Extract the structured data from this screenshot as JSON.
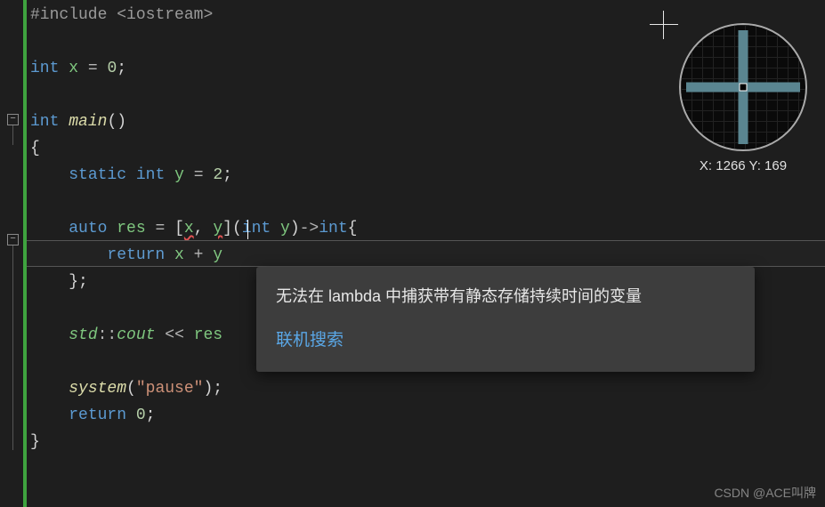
{
  "code": {
    "l1_directive": "#include",
    "l1_header": "<iostream>",
    "l3_type": "int",
    "l3_var": "x",
    "l3_eq": "=",
    "l3_val": "0",
    "l5_type": "int",
    "l5_func": "main",
    "l5_paren": "()",
    "l6_brace": "{",
    "l7_static": "static",
    "l7_int": "int",
    "l7_var": "y",
    "l7_eq": "=",
    "l7_val": "2",
    "l9_auto": "auto",
    "l9_var": "res",
    "l9_eq": "=",
    "l9_lbrack": "[",
    "l9_cap1": "x",
    "l9_comma": ",",
    "l9_cap2": "y",
    "l9_rbrack": "]",
    "l9_lparen": "(",
    "l9_ptype": "int",
    "l9_pname": "y",
    "l9_rparen": ")",
    "l9_arrow": "->",
    "l9_rtype": "int",
    "l9_lbrace": "{",
    "l10_return": "return",
    "l10_x": "x",
    "l10_plus": "+",
    "l10_y": "y",
    "l11_close": "};",
    "l13_std": "std",
    "l13_colon": "::",
    "l13_cout": "cout",
    "l13_shl": "<<",
    "l13_res": "res",
    "l15_system": "system",
    "l15_lparen": "(",
    "l15_str": "\"pause\"",
    "l15_rparen": ");",
    "l16_return": "return",
    "l16_val": "0",
    "l16_semi": ";",
    "l17_brace": "}"
  },
  "tooltip": {
    "message": "无法在 lambda 中捕获带有静态存储持续时间的变量",
    "link": "联机搜索"
  },
  "magnifier": {
    "coords": "X: 1266 Y: 169"
  },
  "watermark": "CSDN @ACE叫牌"
}
